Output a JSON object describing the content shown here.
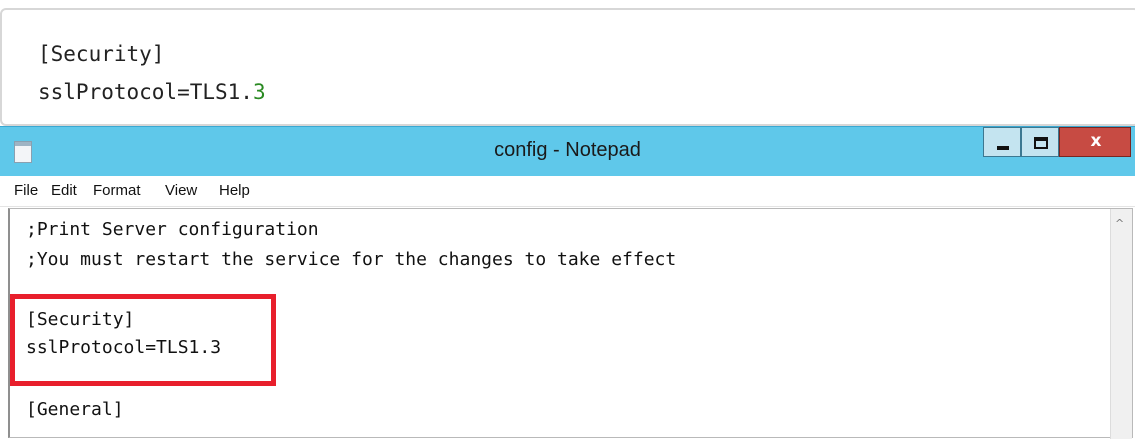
{
  "code_snippet": {
    "line1": "[Security]",
    "line2_prefix": "sslProtocol=TLS1.",
    "line2_number": "3"
  },
  "window": {
    "title": "config - Notepad",
    "controls": {
      "minimize": "minimize",
      "maximize": "maximize",
      "close": "x"
    }
  },
  "menu": {
    "file": "File",
    "edit": "Edit",
    "format": "Format",
    "view": "View",
    "help": "Help"
  },
  "editor": {
    "lines": [
      ";Print Server configuration",
      ";You must restart the service for the changes to take effect",
      "",
      "[Security]",
      "sslProtocol=TLS1.3",
      "",
      "[General]"
    ]
  },
  "colors": {
    "titlebar": "#5fc8ea",
    "close_button": "#c74b43",
    "highlight_border": "#e81f2c",
    "code_number": "#2a8a22"
  }
}
